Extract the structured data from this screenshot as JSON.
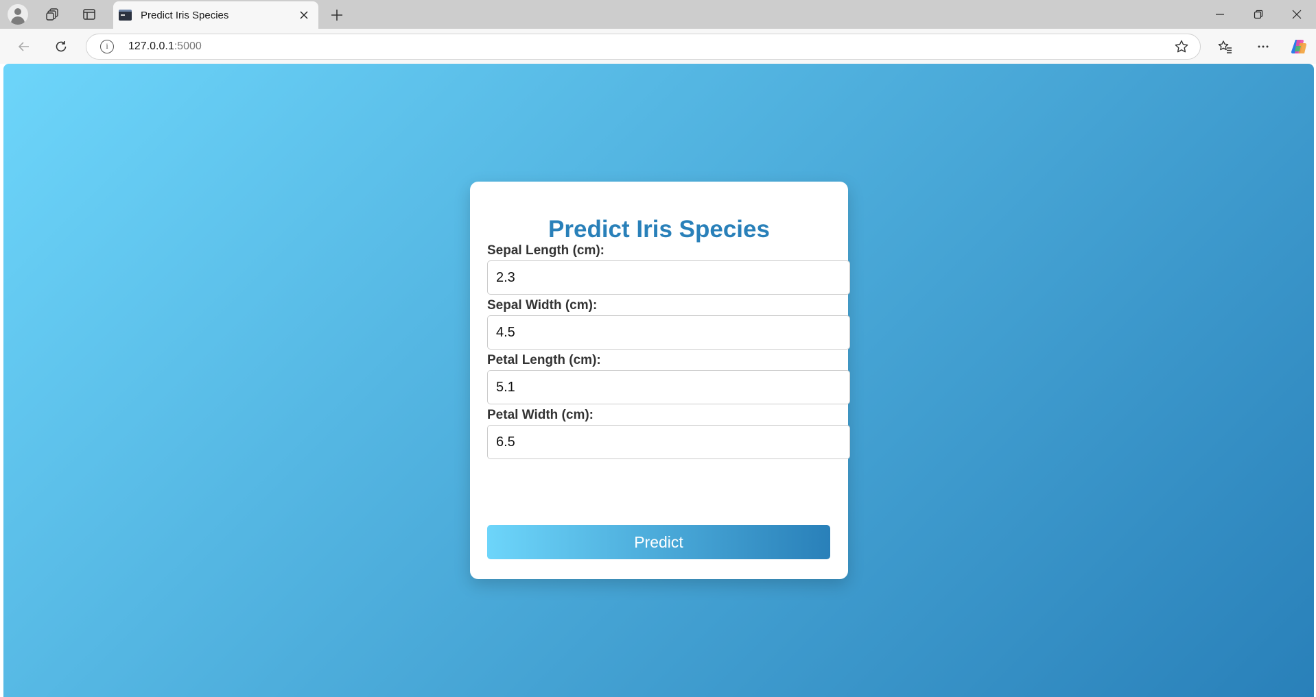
{
  "browser": {
    "tab_title": "Predict Iris Species",
    "url_host": "127.0.0.1",
    "url_port": ":5000"
  },
  "page": {
    "heading": "Predict Iris Species",
    "fields": [
      {
        "label": "Sepal Length (cm):",
        "value": "2.3"
      },
      {
        "label": "Sepal Width (cm):",
        "value": "4.5"
      },
      {
        "label": "Petal Length (cm):",
        "value": "5.1"
      },
      {
        "label": "Petal Width (cm):",
        "value": "6.5"
      }
    ],
    "submit_label": "Predict"
  },
  "colors": {
    "gradient_start": "#6dd5fa",
    "gradient_end": "#2980b9",
    "heading": "#2980b9"
  },
  "icons": [
    "profile-icon",
    "workspaces-icon",
    "vertical-tabs-icon",
    "terminal-favicon-icon",
    "close-icon",
    "plus-icon",
    "minimize-icon",
    "restore-icon",
    "window-close-icon",
    "back-arrow-icon",
    "refresh-icon",
    "info-icon",
    "star-icon",
    "favorites-icon",
    "more-icon",
    "copilot-icon"
  ]
}
